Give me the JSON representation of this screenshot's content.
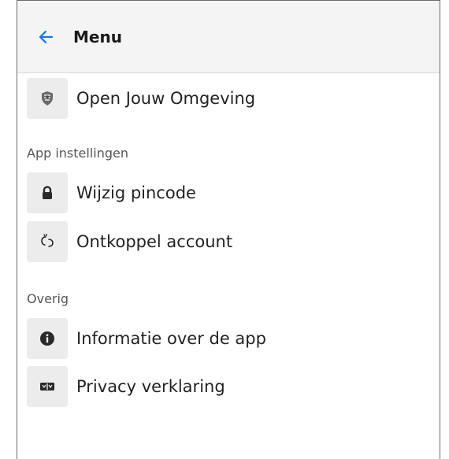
{
  "header": {
    "title": "Menu",
    "back_icon": "arrow-left-icon",
    "accent_color": "#1a73e8"
  },
  "items_top": [
    {
      "label": "Open Jouw Omgeving",
      "icon": "shield-emblem-icon"
    }
  ],
  "sections": [
    {
      "title": "App instellingen",
      "items": [
        {
          "label": "Wijzig pincode",
          "icon": "lock-icon"
        },
        {
          "label": "Ontkoppel account",
          "icon": "unlink-icon"
        }
      ]
    },
    {
      "title": "Overig",
      "items": [
        {
          "label": "Informatie over de app",
          "icon": "info-circle-icon"
        },
        {
          "label": "Privacy verklaring",
          "icon": "scale-icon"
        }
      ]
    }
  ]
}
